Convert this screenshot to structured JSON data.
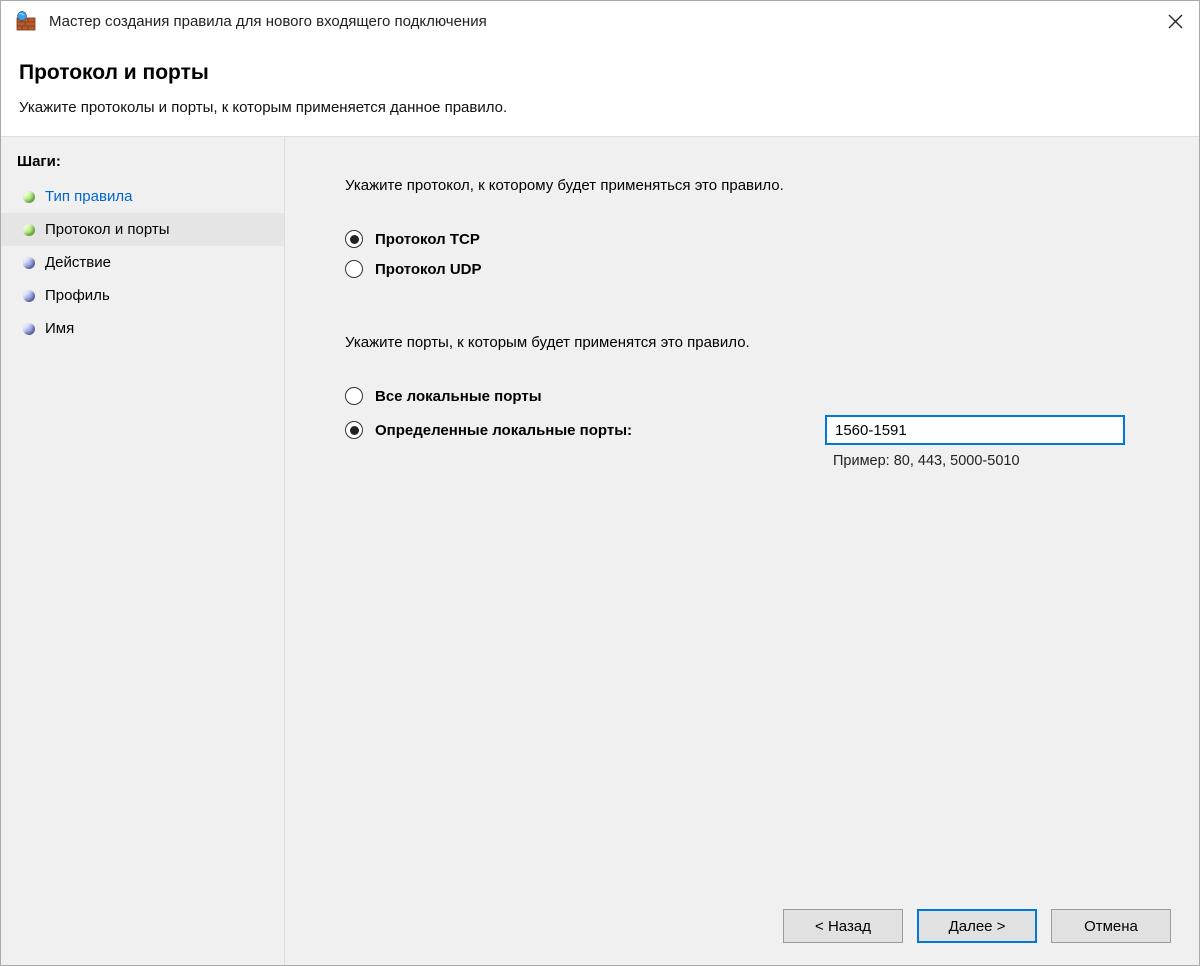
{
  "window": {
    "title": "Мастер создания правила для нового входящего подключения"
  },
  "header": {
    "title": "Протокол и порты",
    "subtitle": "Укажите протоколы и порты, к которым применяется данное правило."
  },
  "sidebar": {
    "heading": "Шаги:",
    "steps": [
      {
        "label": "Тип правила"
      },
      {
        "label": "Протокол и порты"
      },
      {
        "label": "Действие"
      },
      {
        "label": "Профиль"
      },
      {
        "label": "Имя"
      }
    ]
  },
  "main": {
    "protocol_instruction": "Укажите протокол, к которому будет применяться это правило.",
    "protocol_options": {
      "tcp": "Протокол TCP",
      "udp": "Протокол UDP"
    },
    "ports_instruction": "Укажите порты, к которым будет применятся это правило.",
    "ports_options": {
      "all": "Все локальные порты",
      "specific": "Определенные локальные порты:"
    },
    "port_value": "1560-1591",
    "port_example": "Пример: 80, 443, 5000-5010"
  },
  "footer": {
    "back": "< Назад",
    "next": "Далее >",
    "cancel": "Отмена"
  },
  "icons": {
    "app": "firewall-icon",
    "close": "close-icon"
  }
}
